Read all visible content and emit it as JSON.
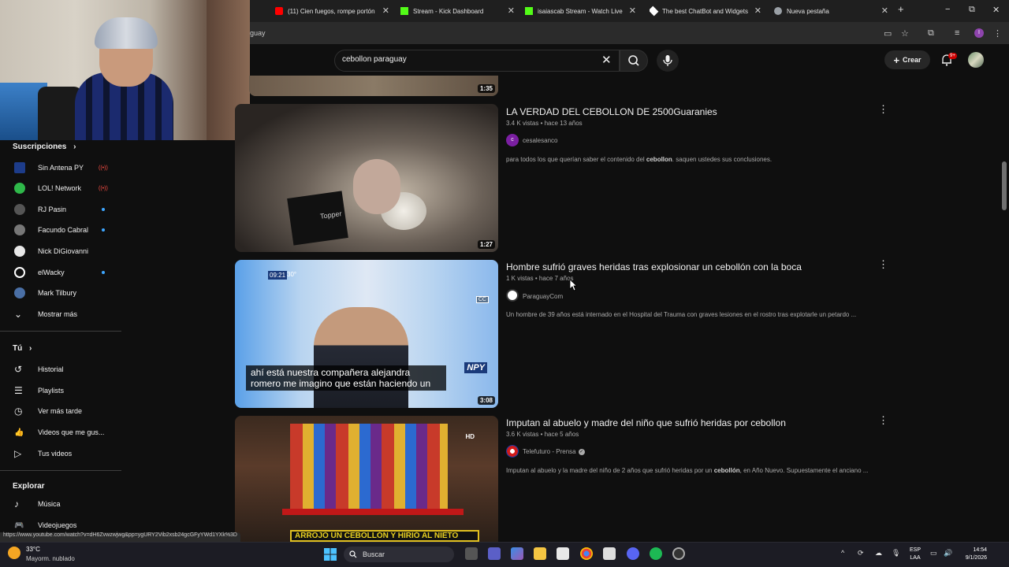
{
  "browser": {
    "tabs": [
      {
        "label": "(11) Cien fuegos, rompe portón",
        "color": "#ff0000"
      },
      {
        "label": "Stream - Kick Dashboard",
        "color": "#53fc18"
      },
      {
        "label": "isaiascab Stream - Watch Live on",
        "color": "#53fc18"
      },
      {
        "label": "The best ChatBot and Widgets",
        "color": "#ffffff"
      },
      {
        "label": "Nueva pestaña",
        "color": "#9aa0a6"
      }
    ],
    "new_tab": "+",
    "min": "−",
    "max": "⧉",
    "close": "✕",
    "url_fragment": "guay",
    "profile_initial": "I"
  },
  "header": {
    "search_value": "cebollon paraguay",
    "create_label": "Crear",
    "notifications_badge": "9+"
  },
  "sidebar": {
    "subscriptions_title": "Suscripciones",
    "subscriptions": [
      {
        "label": "Sin Antena PY",
        "status": "live",
        "color": "#1d3c8a"
      },
      {
        "label": "LOL! Network",
        "status": "live",
        "color": "#2fb84a"
      },
      {
        "label": "RJ Pasin",
        "status": "dot",
        "color": "#555555"
      },
      {
        "label": "Facundo Cabral",
        "status": "dot",
        "color": "#777777"
      },
      {
        "label": "Nick DiGiovanni",
        "status": "none",
        "color": "#e8e8e8"
      },
      {
        "label": "elWacky",
        "status": "dot",
        "color": "#ffffff"
      },
      {
        "label": "Mark Tilbury",
        "status": "none",
        "color": "#4a6fa5"
      }
    ],
    "show_more": "Mostrar más",
    "you_title": "Tú",
    "you_items": [
      {
        "label": "Historial",
        "icon": "history-icon",
        "glyph": "↺"
      },
      {
        "label": "Playlists",
        "icon": "playlists-icon",
        "glyph": "☰"
      },
      {
        "label": "Ver más tarde",
        "icon": "watch-later-icon",
        "glyph": "◷"
      },
      {
        "label": "Videos que me gus...",
        "icon": "liked-icon",
        "glyph": "👍"
      },
      {
        "label": "Tus videos",
        "icon": "your-videos-icon",
        "glyph": "▷"
      }
    ],
    "explore_title": "Explorar",
    "explore_items": [
      {
        "label": "Música",
        "icon": "music-icon",
        "glyph": "♪"
      },
      {
        "label": "Videojuegos",
        "icon": "gaming-icon",
        "glyph": "🎮"
      }
    ]
  },
  "results": [
    {
      "duration": "1:35"
    },
    {
      "title": "LA VERDAD DEL CEBOLLON DE 2500Guaranies",
      "meta": "3.4 K vistas • hace 13 años",
      "channel": "cesalesanco",
      "channel_initial": "c",
      "description_before": "para todos los que querían saber el contenido del ",
      "description_bold": "cebollon",
      "description_after": ". saquen ustedes sus conclusiones.",
      "duration": "1:27",
      "thumb_label": "Topper"
    },
    {
      "title": "Hombre sufrió graves heridas tras explosionar un cebollón con la boca",
      "meta": "1 K vistas • hace 7 años",
      "channel": "ParaguayCom",
      "description_before": "Un hombre de 39 años está internado en el Hospital del Trauma con graves lesiones en el rostro tras explotarle un petardo ...",
      "description_bold": "",
      "description_after": "",
      "duration": "3:08",
      "caption_line1": "ahí está nuestra compañera alejandra",
      "caption_line2": "romero me imagino que están haciendo un",
      "overlay_time": "09:21",
      "overlay_temp": "30°",
      "overlay_cc": "CC",
      "overlay_logo": "NPY"
    },
    {
      "title": "Imputan al abuelo y madre del niño que sufrió heridas por cebollon",
      "meta": "3.6 K vistas • hace 5 años",
      "channel": "Telefuturo - Prensa",
      "description_before": "Imputan al abuelo y la madre del niño de 2 años que sufrió heridas por un ",
      "description_bold": "cebollón",
      "description_after": ", en Año Nuevo. Supuestamente el anciano ...",
      "thumb_banner": "ARROJÓ UN CEBOLLÓN Y HIRIÓ AL NIETO",
      "thumb_hd": "HD"
    }
  ],
  "status_url": "https://www.youtube.com/watch?v=dH6Zvwzwjwg&pp=ygURY2Vib2xsb24gcGFyYWd1YXk%3D",
  "taskbar": {
    "temp": "33°C",
    "condition": "Mayorm. nublado",
    "search_label": "Buscar",
    "lang_line1": "ESP",
    "lang_line2": "LAA",
    "time": "14:54",
    "date": "9/1/2026"
  }
}
